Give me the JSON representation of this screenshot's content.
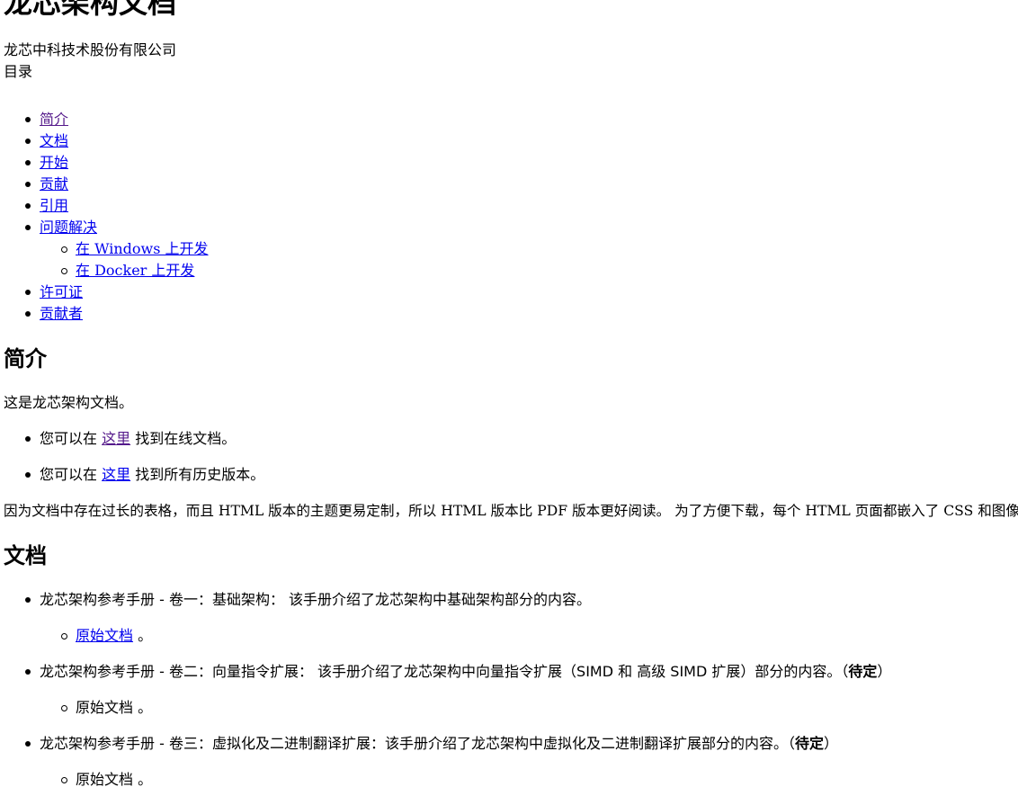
{
  "title": "龙芯架构文档",
  "subtitle": "龙芯中科技术股份有限公司",
  "toc": {
    "heading": "目录",
    "items": [
      {
        "label": "简介",
        "visited": true
      },
      {
        "label": "文档",
        "visited": false
      },
      {
        "label": "开始",
        "visited": false
      },
      {
        "label": "贡献",
        "visited": false
      },
      {
        "label": "引用",
        "visited": false
      },
      {
        "label": "问题解决",
        "visited": false
      },
      {
        "label": "在 Windows 上开发",
        "visited": false,
        "sub": true
      },
      {
        "label": "在 Docker 上开发",
        "visited": false,
        "sub": true
      },
      {
        "label": "许可证",
        "visited": false
      },
      {
        "label": "贡献者",
        "visited": false
      }
    ]
  },
  "intro": {
    "heading": "简介",
    "para1": "这是龙芯架构文档。",
    "bullets": [
      {
        "prefix": "您可以在 ",
        "link": "这里",
        "suffix": " 找到在线文档。"
      },
      {
        "prefix": "您可以在 ",
        "link": "这里",
        "suffix": " 找到所有历史版本。"
      }
    ],
    "para2": "因为文档中存在过长的表格，而且 HTML 版本的主题更易定制，所以 HTML 版本比 PDF 版本更好阅读。 为了方便下载，每个 HTML 页面都嵌入了 CSS 和图像。"
  },
  "docs": {
    "heading": "文档",
    "items": [
      {
        "text": "龙芯架构参考手册 - 卷一：基础架构： 该手册介绍了龙芯架构中基础架构部分的内容。",
        "tag": "",
        "sub_link": "原始文档",
        "sub_suffix": " 。",
        "sub_is_link": true
      },
      {
        "text": "龙芯架构参考手册 - 卷二：向量指令扩展： 该手册介绍了龙芯架构中向量指令扩展（SIMD 和 高级 SIMD 扩展）部分的内容。（",
        "tag": "待定",
        "tag_close": "）",
        "sub_link": "原始文档",
        "sub_suffix": " 。",
        "sub_is_link": false
      },
      {
        "text": "龙芯架构参考手册 - 卷三：虚拟化及二进制翻译扩展：该手册介绍了龙芯架构中虚拟化及二进制翻译扩展部分的内容。（",
        "tag": "待定",
        "tag_close": "）",
        "sub_link": "原始文档",
        "sub_suffix": " 。",
        "sub_is_link": false
      }
    ]
  },
  "colors": {
    "link": "#0000ee",
    "link_visited": "#551a8b",
    "text": "#000000",
    "background": "#ffffff"
  }
}
